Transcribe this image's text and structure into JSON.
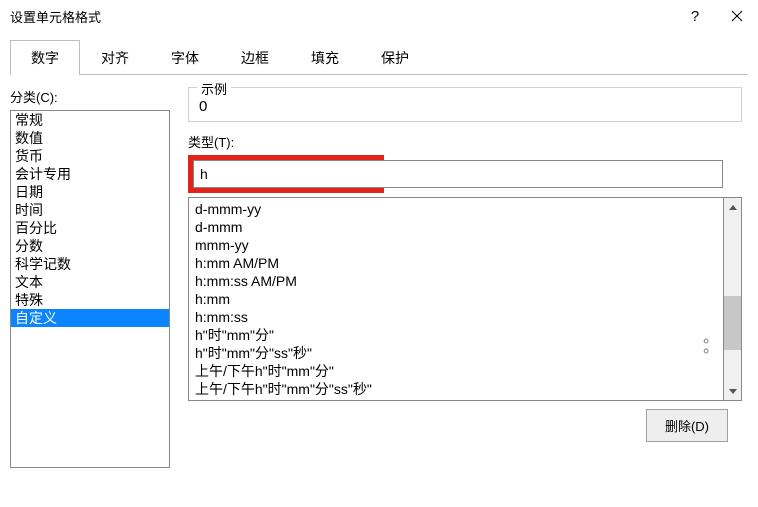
{
  "window": {
    "title": "设置单元格格式"
  },
  "tabs": {
    "items": [
      "数字",
      "对齐",
      "字体",
      "边框",
      "填充",
      "保护"
    ],
    "active_index": 0
  },
  "category": {
    "label": "分类(C):",
    "items": [
      "常规",
      "数值",
      "货币",
      "会计专用",
      "日期",
      "时间",
      "百分比",
      "分数",
      "科学记数",
      "文本",
      "特殊",
      "自定义"
    ],
    "selected_index": 11
  },
  "sample": {
    "group_title": "示例",
    "value": "0"
  },
  "type": {
    "label": "类型(T):",
    "value": "h",
    "options": [
      "d-mmm-yy",
      "d-mmm",
      "mmm-yy",
      "h:mm AM/PM",
      "h:mm:ss AM/PM",
      "h:mm",
      "h:mm:ss",
      "h\"时\"mm\"分\"",
      "h\"时\"mm\"分\"ss\"秒\"",
      "上午/下午h\"时\"mm\"分\"",
      "上午/下午h\"时\"mm\"分\"ss\"秒\""
    ]
  },
  "buttons": {
    "delete_label": "删除(D)"
  }
}
